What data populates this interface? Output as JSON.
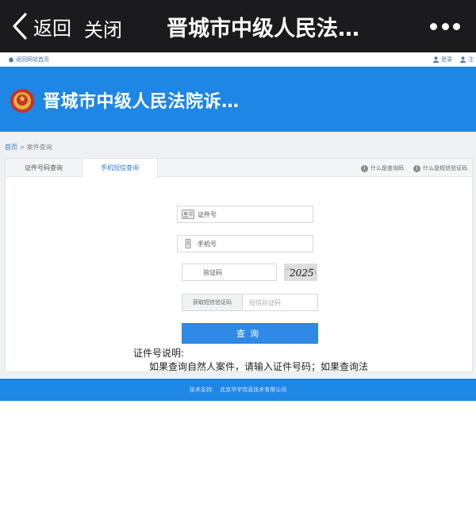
{
  "wechat_bar": {
    "back_label": "返回",
    "close_label": "关闭",
    "title": "晋城市中级人民法…",
    "more_icon": "more-dots-icon"
  },
  "utility": {
    "home_link": "返回网站首页",
    "login_link": "登录",
    "register_link": "注"
  },
  "header": {
    "title": "晋城市中级人民法院诉…",
    "emblem_icon": "court-emblem-icon",
    "background": "#1e86e4"
  },
  "breadcrumb": {
    "home": "首页",
    "separator": ">",
    "current": "案件查询"
  },
  "tabs": [
    {
      "label": "证件号码查询",
      "active": false
    },
    {
      "label": "手机短信查询",
      "active": true
    }
  ],
  "help_links": [
    {
      "label": "什么是查询码"
    },
    {
      "label": "什么是短信验证码"
    }
  ],
  "form": {
    "id_placeholder": "证件号",
    "phone_placeholder": "手机号",
    "captcha_placeholder": "验证码",
    "captcha_text": "2025",
    "sms_button_label": "获取短信验证码",
    "sms_placeholder": "短信验证码",
    "submit_label": "查询"
  },
  "note": {
    "title": "证件号说明:",
    "body": "如果查询自然人案件，请输入证件号码；如果查询法"
  },
  "footer": {
    "label": "技术支持:",
    "company": "北京华宇信息技术有限公司"
  },
  "colors": {
    "accent": "#1e86e4",
    "wechat_bar": "#1b1b1d",
    "button": "#2e8ae6"
  }
}
